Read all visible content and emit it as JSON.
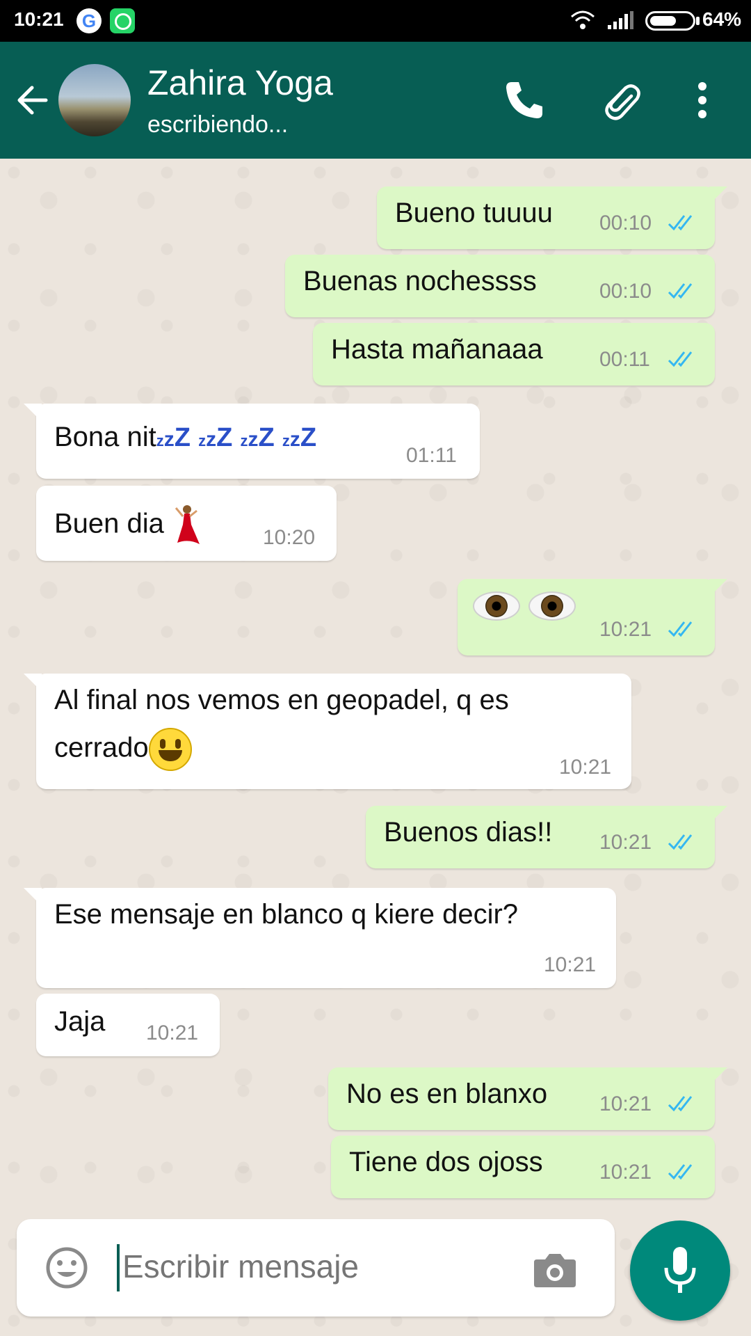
{
  "status_bar": {
    "time": "10:21",
    "battery": "64%",
    "battery_level": 0.64
  },
  "header": {
    "contact_name": "Zahira Yoga",
    "status": "escribiendo...",
    "icons": [
      "back-arrow-icon",
      "avatar",
      "phone-icon",
      "paperclip-icon",
      "more-vert-icon"
    ]
  },
  "messages": [
    {
      "dir": "out",
      "text": "Bueno tuuuu",
      "time": "00:10",
      "read": true
    },
    {
      "dir": "out",
      "text": "Buenas nochessss",
      "time": "00:10",
      "read": true
    },
    {
      "dir": "out",
      "text": "Hasta mañanaaa",
      "time": "00:11",
      "read": true
    },
    {
      "dir": "in",
      "text": "Bona nit",
      "emoji": "zzz x4",
      "time": "01:11"
    },
    {
      "dir": "in",
      "text": "Buen dia",
      "emoji": "dancer",
      "time": "10:20"
    },
    {
      "dir": "out",
      "text": "",
      "emoji": "eyes",
      "time": "10:21",
      "read": true
    },
    {
      "dir": "in",
      "text_line1": "Al final nos vemos en geopadel, q es",
      "text_line2": "cerrado",
      "emoji": "smiley",
      "time": "10:21"
    },
    {
      "dir": "out",
      "text": "Buenos dias!!",
      "time": "10:21",
      "read": true
    },
    {
      "dir": "in",
      "text": "Ese mensaje en blanco q kiere decir?",
      "time": "10:21"
    },
    {
      "dir": "in",
      "text": "Jaja",
      "time": "10:21"
    },
    {
      "dir": "out",
      "text": "No es en blanxo",
      "time": "10:21",
      "read": true
    },
    {
      "dir": "out",
      "text": "Tiene dos ojoss",
      "time": "10:21",
      "read": true
    }
  ],
  "composer": {
    "placeholder": "Escribir mensaje"
  },
  "colors": {
    "header": "#075E54",
    "outgoing": "#DCF8C6",
    "incoming": "#FFFFFF",
    "tick": "#34B7F1",
    "fab": "#00897B"
  }
}
